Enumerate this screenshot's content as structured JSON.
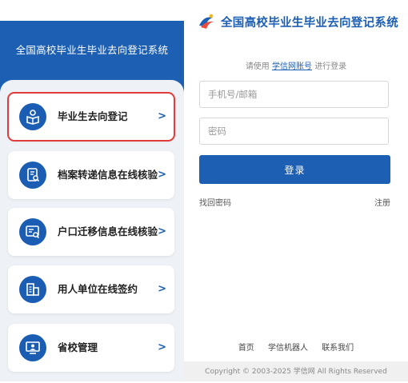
{
  "mobile": {
    "header_title": "全国高校毕业生毕业去向登记系统",
    "menu": [
      {
        "label": "毕业生去向登记",
        "arrow": ">"
      },
      {
        "label": "档案转递信息在线核验",
        "arrow": ">"
      },
      {
        "label": "户口迁移信息在线核验",
        "arrow": ">"
      },
      {
        "label": "用人单位在线签约",
        "arrow": ">"
      },
      {
        "label": "省校管理",
        "arrow": ">"
      }
    ],
    "selected_item": "毕业生去向登记"
  },
  "web": {
    "brand_name": "全国高校毕业生毕业去向登记系统",
    "login_hint_prefix": "请使用",
    "login_hint_link": "学信网账号",
    "login_hint_suffix": "进行登录",
    "username_placeholder": "手机号/邮箱",
    "password_placeholder": "密码",
    "login_button": "登录",
    "forgot_password": "找回密码",
    "register": "注册",
    "footer_links": [
      "首页",
      "学信机器人",
      "联系我们"
    ],
    "copyright": "Copyright © 2003-2025  学信网  All Rights Reserved"
  },
  "colors": {
    "brand_blue": "#1d5fb3",
    "selection_red": "#e23b3b",
    "panel_bg": "#eef1f6"
  }
}
